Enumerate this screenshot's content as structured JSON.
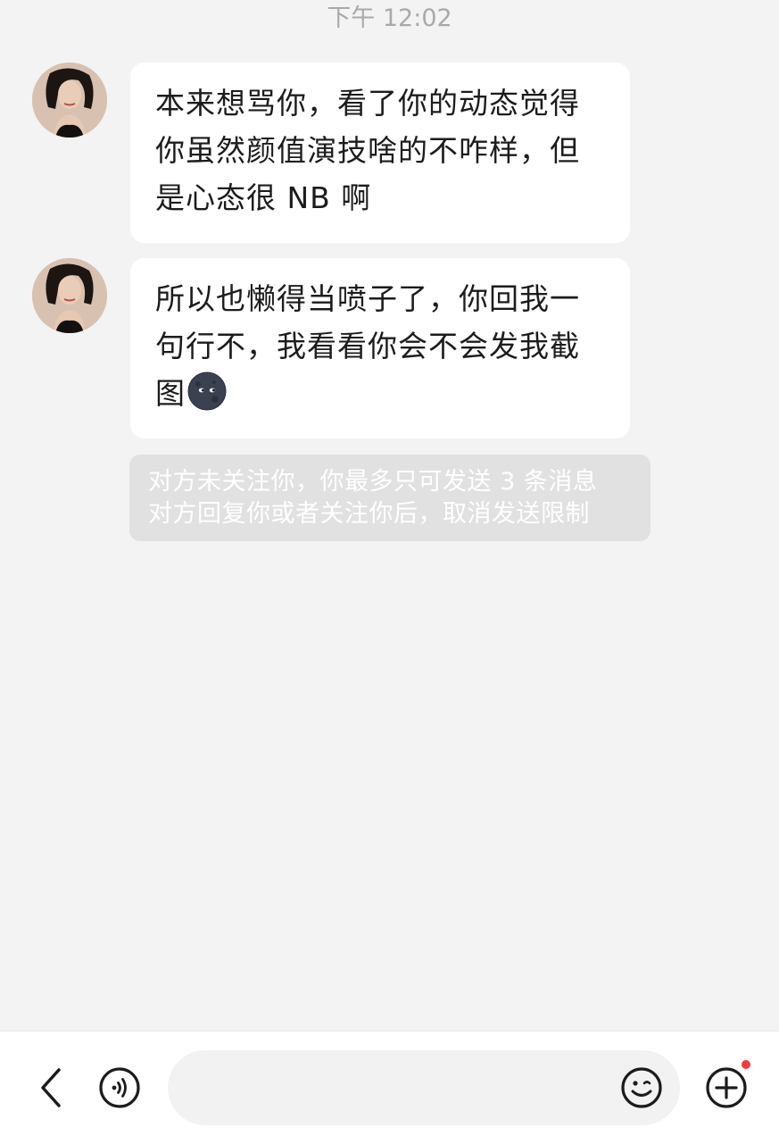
{
  "chat": {
    "timestamp": "下午 12:02",
    "messages": [
      {
        "sender": "other",
        "lines": [
          "本来想骂你，看了你的动态觉得",
          "你虽然颜值演技啥的不咋样，但",
          "是心态很 NB 啊"
        ]
      },
      {
        "sender": "other",
        "lines": [
          "所以也懒得当喷子了，你回我一",
          "句行不，我看看你会不会发我截",
          "图"
        ],
        "emoji": "new-moon-face"
      }
    ],
    "notice": {
      "line1": "对方未关注你，你最多只可发送 3 条消息",
      "line2": "对方回复你或者关注你后，取消发送限制"
    }
  },
  "input_bar": {
    "placeholder": "",
    "value": "",
    "icons": {
      "back": "chevron-left-icon",
      "voice": "voice-icon",
      "emoji": "smiley-icon",
      "plus": "plus-circle-icon"
    },
    "plus_badge_color": "#f23b3b"
  },
  "colors": {
    "background": "#f3f3f3",
    "bubble": "#ffffff",
    "notice_bg": "#e1e1e1",
    "timestamp": "#a9a9a9"
  }
}
